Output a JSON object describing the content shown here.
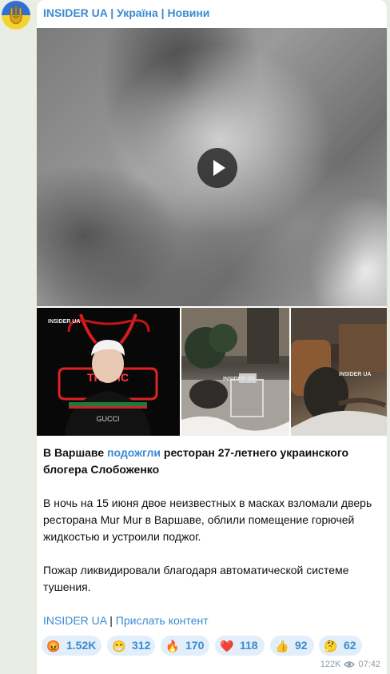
{
  "channel": {
    "name": "INSIDER UA | Україна | Новини",
    "avatar_icon": "trident-icon"
  },
  "media": {
    "video_icon": "play-icon",
    "watermark": "INSIDER UA",
    "neon_sign": "TRAPIC",
    "shirt_text": "GUCCI"
  },
  "post": {
    "headline_pre": "В Варшаве ",
    "headline_link": "подожгли",
    "headline_post": " ресторан 27-летнего украинского блогера Слобоженко",
    "para1": "В ночь на 15 июня двое неизвестных в масках взломали дверь ресторана Mur Mur в Варшаве, облили помещение горючей жидкостью и устроили поджог.",
    "para2": "Пожар ликвидировали благодаря автоматической системе тушения.",
    "footer_link1": "INSIDER UA",
    "footer_sep": " | ",
    "footer_link2": "Прислать контент"
  },
  "reactions": [
    {
      "emoji": "😡",
      "count": "1.52K"
    },
    {
      "emoji": "😁",
      "count": "312"
    },
    {
      "emoji": "🔥",
      "count": "170"
    },
    {
      "emoji": "❤️",
      "count": "118"
    },
    {
      "emoji": "👍",
      "count": "92"
    },
    {
      "emoji": "🤔",
      "count": "62"
    }
  ],
  "meta": {
    "views": "122K",
    "time": "07:42",
    "views_icon": "eye-icon"
  },
  "colors": {
    "link": "#3a8ad0",
    "reaction_bg": "#e2eefa",
    "chat_bg": "#e8eee4"
  }
}
